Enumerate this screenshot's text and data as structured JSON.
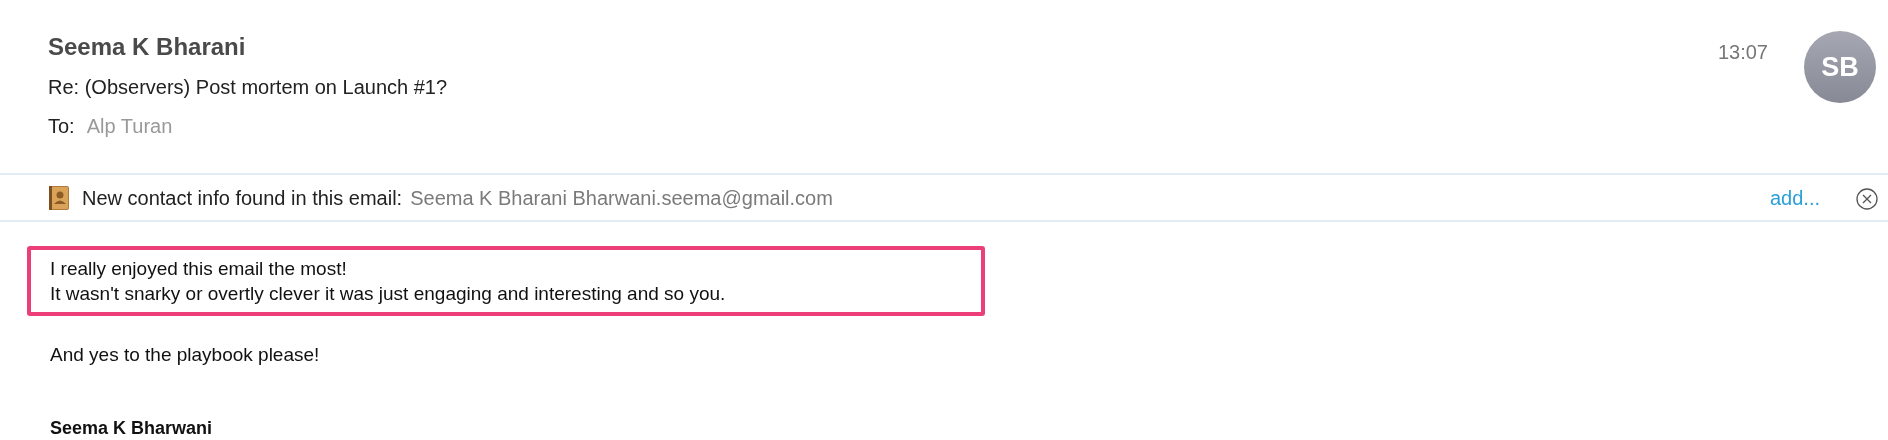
{
  "header": {
    "sender": "Seema K Bharani",
    "subject": "Re: (Observers) Post mortem on Launch #1?",
    "to_label": "To:",
    "recipient": "Alp Turan",
    "time": "13:07",
    "avatar_initials": "SB"
  },
  "contact_banner": {
    "message": "New contact info found in this email:",
    "contact": "Seema K Bharani Bharwani.seema@gmail.com",
    "action": "add..."
  },
  "body": {
    "highlighted_lines": [
      "I really enjoyed this email the most!",
      "It wasn't snarky or overtly clever it was just engaging and interesting and so you."
    ],
    "paragraph": "And yes to the playbook please!",
    "signature": "Seema K Bharwani"
  }
}
